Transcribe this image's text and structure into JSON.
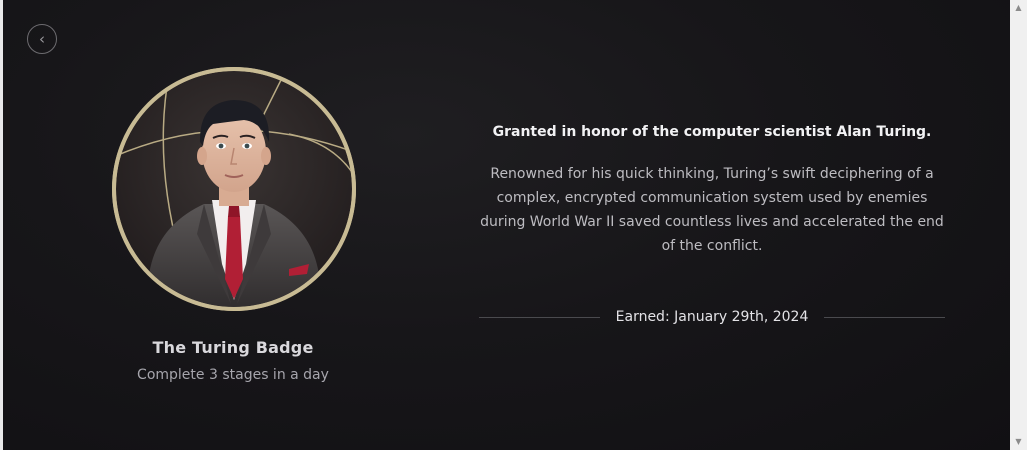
{
  "back": {
    "icon": "chevron-left-icon",
    "glyph": "‹"
  },
  "badge": {
    "name": "The Turing Badge",
    "requirement": "Complete 3 stages in a day",
    "image_icon": "alan-turing-avatar"
  },
  "details": {
    "headline": "Granted in honor of the computer scientist Alan Turing.",
    "description": "Renowned for his quick thinking, Turing’s swift deciphering of a complex, encrypted communication system used by enemies during World War II saved countless lives and accelerated the end of the conflict.",
    "earned": "Earned: January 29th, 2024"
  },
  "scrollbar": {
    "up": "▲",
    "down": "▼"
  },
  "colors": {
    "accent_ring": "#b9ab84",
    "background": "#151417",
    "tie": "#b11f35"
  }
}
